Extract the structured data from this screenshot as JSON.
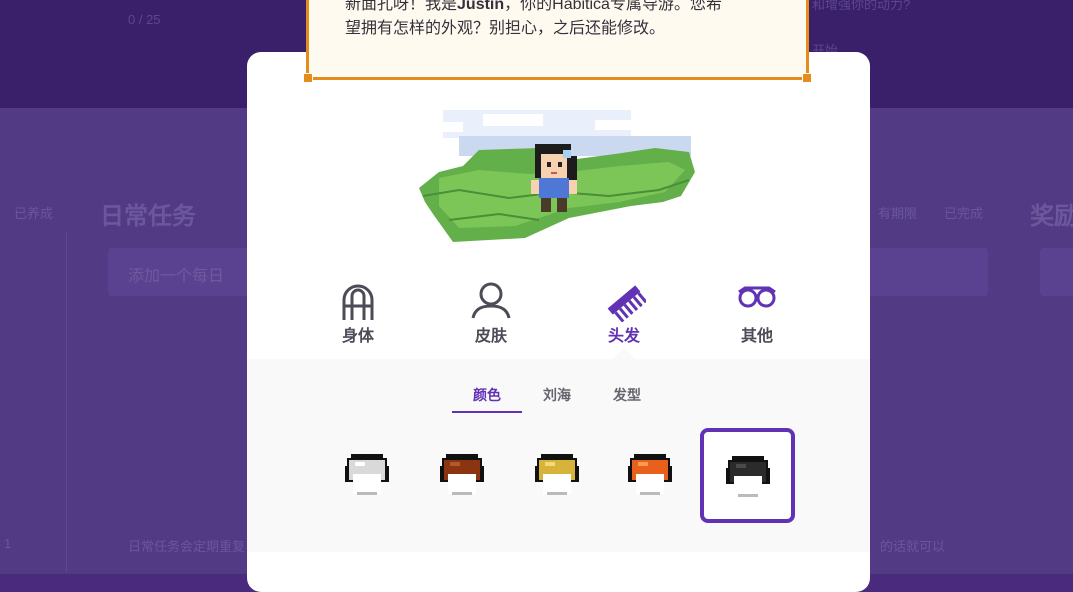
{
  "background": {
    "progress": "0 / 25",
    "top_right_text": "和增强你的动力?",
    "start_button": "开始",
    "left_status": "已养成",
    "dailies_title": "日常任务",
    "add_daily_placeholder": "添加一个每日",
    "filter_due": "有期限",
    "filter_done": "已完成",
    "rewards_title": "奖励",
    "dailies_hint": "日常任务会定期重复",
    "bottom_left_number": "1",
    "rewards_hint": "的话就可以"
  },
  "guide": {
    "line1_prefix": "新面孔呀！我是",
    "guide_name": "Justin",
    "line1_suffix": "，你的Habitica专属导游。您希",
    "line2": "望拥有怎样的外观？别担心，之后还能修改。"
  },
  "customize": {
    "tabs": [
      {
        "label": "身体",
        "icon": "body-icon"
      },
      {
        "label": "皮肤",
        "icon": "skin-icon"
      },
      {
        "label": "头发",
        "icon": "comb-icon",
        "active": true
      },
      {
        "label": "其他",
        "icon": "glasses-icon"
      }
    ],
    "subtabs": [
      {
        "label": "颜色",
        "active": true
      },
      {
        "label": "刘海"
      },
      {
        "label": "发型"
      }
    ],
    "hair_colors": [
      {
        "name": "white",
        "color": "#d9d9d9"
      },
      {
        "name": "brown",
        "color": "#8a3412"
      },
      {
        "name": "blond",
        "color": "#d7b33a"
      },
      {
        "name": "red",
        "color": "#e8601c"
      },
      {
        "name": "black",
        "color": "#2b2b2b",
        "selected": true
      }
    ]
  },
  "colors": {
    "accent": "#6133b4",
    "guide_border": "#e48c1c"
  }
}
